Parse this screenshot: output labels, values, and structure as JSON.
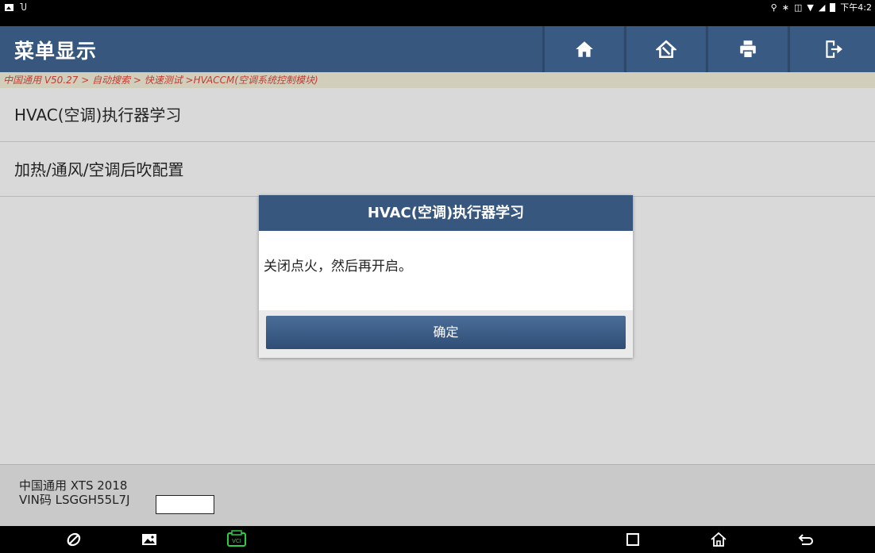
{
  "status_bar": {
    "time": "下午4:2"
  },
  "header": {
    "title": "菜单显示"
  },
  "breadcrumb": "中国通用 V50.27 > 自动搜索 > 快速测试 >HVACCM(空调系统控制模块)",
  "menu": {
    "items": [
      {
        "label": "HVAC(空调)执行器学习"
      },
      {
        "label": "加热/通风/空调后吹配置"
      }
    ]
  },
  "dialog": {
    "title": "HVAC(空调)执行器学习",
    "message": "关闭点火，然后再开启。",
    "confirm_label": "确定"
  },
  "footer": {
    "vehicle": "中国通用 XTS 2018",
    "vin": "VIN码 LSGGH55L7J"
  },
  "colors": {
    "header_blue": "#38577f",
    "breadcrumb_red": "#c23a2f"
  }
}
